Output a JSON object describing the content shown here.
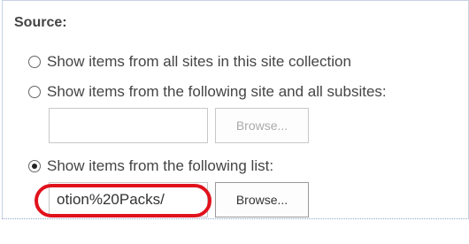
{
  "section": {
    "title": "Source:"
  },
  "options": [
    {
      "label": "Show items from all sites in this site collection",
      "checked": false
    },
    {
      "label": "Show items from the following site and all subsites:",
      "checked": false
    },
    {
      "label": "Show items from the following list:",
      "checked": true
    }
  ],
  "site_input": {
    "value": ""
  },
  "site_browse": {
    "label": "Browse...",
    "enabled": false
  },
  "list_input": {
    "value": "otion%20Packs/"
  },
  "list_browse": {
    "label": "Browse...",
    "enabled": true
  },
  "annotation": {
    "color": "#e0121c"
  }
}
